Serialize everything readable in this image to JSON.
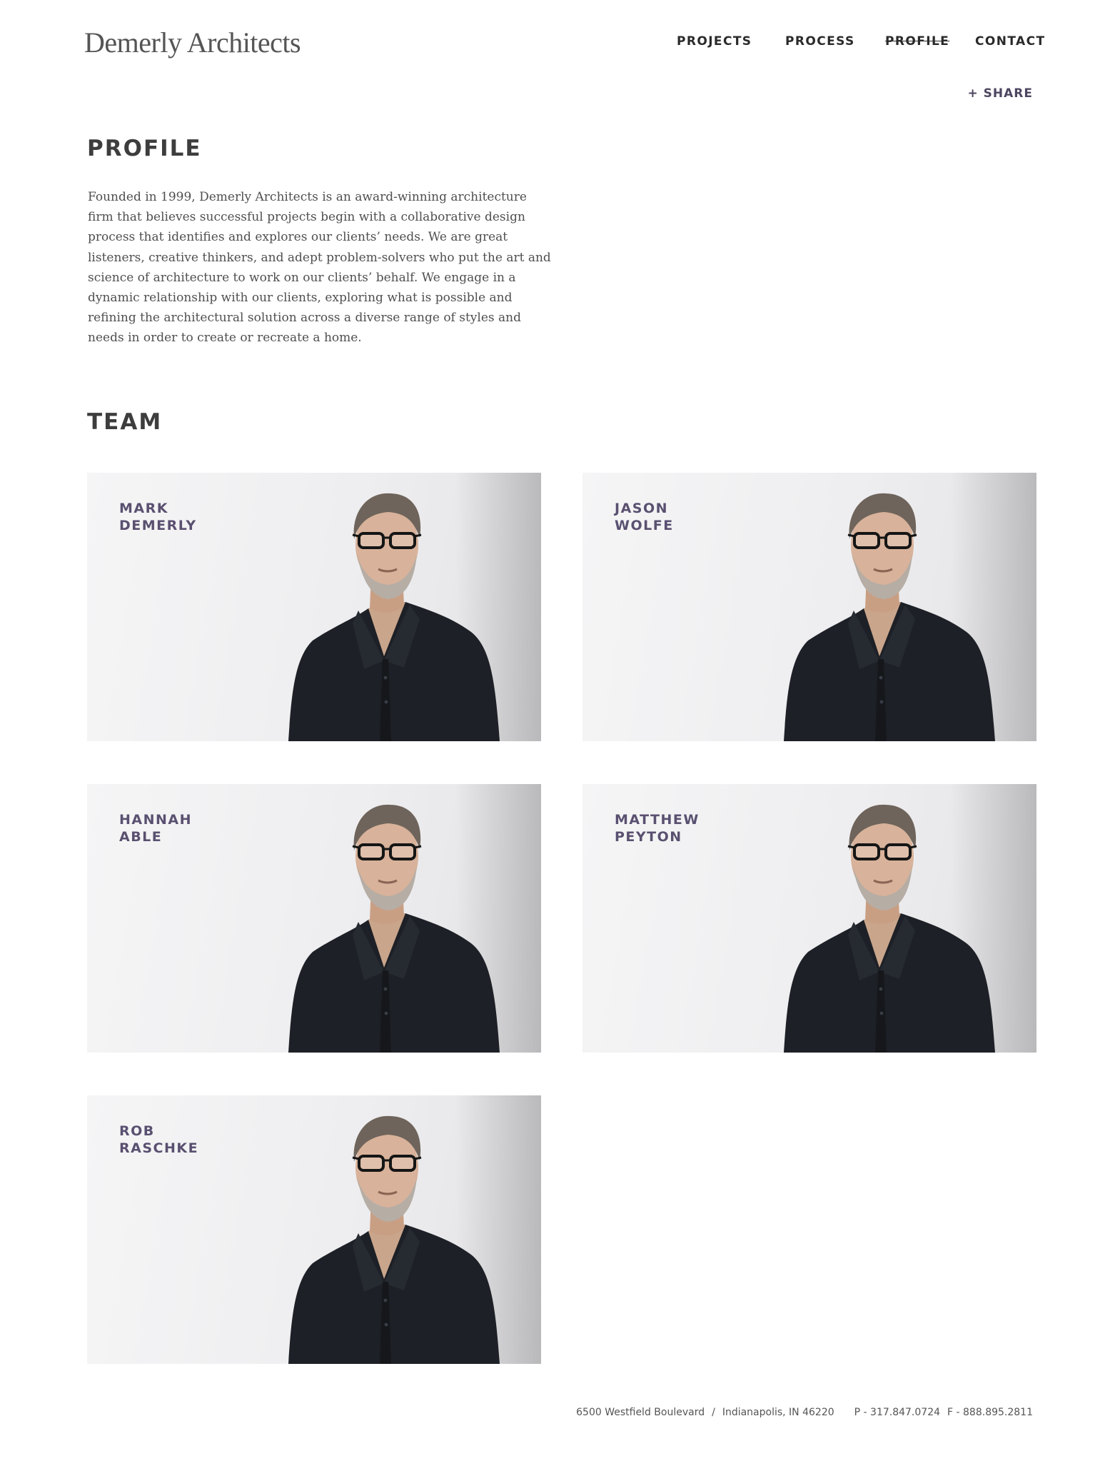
{
  "header": {
    "logo": "Demerly Architects",
    "nav": [
      "PROJECTS",
      "PROCESS",
      "PROFILE",
      "CONTACT"
    ],
    "active_nav": "PROFILE",
    "share": "+ SHARE"
  },
  "profile": {
    "title": "PROFILE",
    "text": "Founded in 1999, Demerly Architects is an award-winning architecture firm that believes successful projects begin with a collaborative design process that identifies and explores our clients’ needs. We are great listeners, creative thinkers, and adept problem-solvers who put the art and science of architecture to work on our clients’ behalf. We engage in a dynamic relationship with our clients, exploring what is possible and refining the architectural solution across a diverse range of styles and needs in order to create or recreate a home."
  },
  "team": {
    "title": "TEAM",
    "members": [
      {
        "first": "MARK",
        "last": "DEMERLY"
      },
      {
        "first": "JASON",
        "last": "WOLFE"
      },
      {
        "first": "HANNAH",
        "last": "ABLE"
      },
      {
        "first": "MATTHEW",
        "last": "PEYTON"
      },
      {
        "first": "ROB",
        "last": "RASCHKE"
      }
    ]
  },
  "footer": {
    "street": "6500 Westfield Boulevard",
    "separator": "/",
    "city": "Indianapolis, IN 46220",
    "phone": "P - 317.847.0724",
    "fax": "F - 888.895.2811"
  },
  "colors": {
    "accent": "#5a5070",
    "text": "#3f3f3f",
    "shirt": "#1d2026"
  }
}
